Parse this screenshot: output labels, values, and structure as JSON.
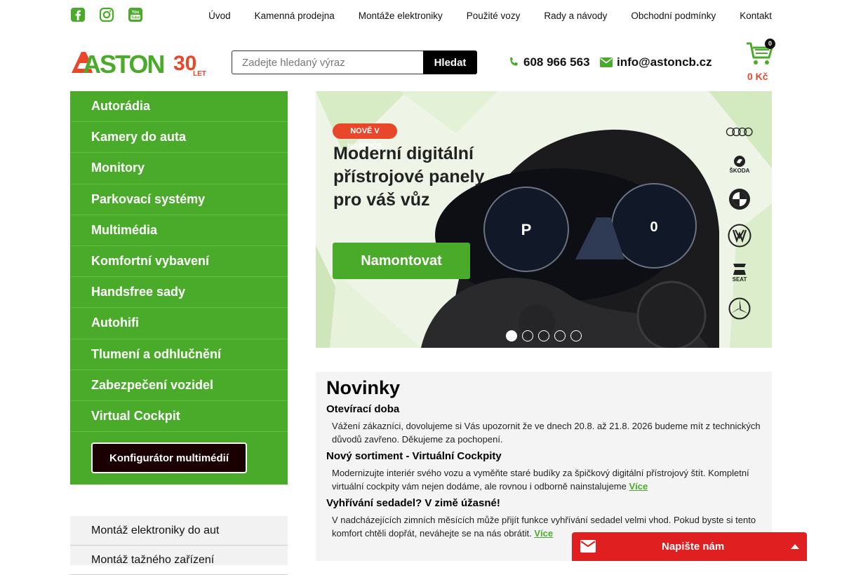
{
  "social": {
    "icons": [
      "facebook-icon",
      "instagram-icon",
      "youtube-icon"
    ],
    "color": "#4aab2b"
  },
  "topnav": [
    "Úvod",
    "Kamenná prodejna",
    "Montáže elektroniky",
    "Použité vozy",
    "Rady a návody",
    "Obchodní podmínky",
    "Kontakt"
  ],
  "logo": {
    "text": "ASTON",
    "anniversary": "30",
    "anniversary_label": "LET"
  },
  "search": {
    "placeholder": "Zadejte hledaný výraz",
    "button": "Hledat"
  },
  "contact": {
    "phone": "608 966 563",
    "email": "info@astoncb.cz"
  },
  "cart": {
    "count": "0",
    "total": "0 Kč"
  },
  "sidebar": {
    "items": [
      "Autorádia",
      "Kamery do auta",
      "Monitory",
      "Parkovací systémy",
      "Multimédia",
      "Komfortní vybavení",
      "Handsfree sady",
      "Autohifi",
      "Tlumení a odhlučnění",
      "Zabezpečení vozidel",
      "Virtual Cockpit"
    ],
    "config_button": "Konfigurátor multimédií",
    "secondary": [
      "Montáž elektroniky do aut",
      "Montáž tažného zařízení"
    ]
  },
  "banner": {
    "tag": "NOVĚ V NABÍDCE",
    "headline": "Moderní digitální přístrojové panely pro váš vůz",
    "button": "Namontovat",
    "brands": [
      "ŠKODA",
      "SEAT"
    ],
    "slides": 5,
    "active_slide": 1
  },
  "news": {
    "title": "Novinky",
    "items": [
      {
        "title": "Otevírací doba",
        "text": "Vážení zákazníci, dovolujeme si Vás upozornit že ve dnech 20.8. až 21.8. 2026 budeme mít z technických důvodů zavřeno. Děkujeme za pochopení.",
        "more": ""
      },
      {
        "title": "Nový sortiment - Virtuální Cockpity",
        "text": "Modernizujte interiér svého vozu a vyměňte staré budíky za špičkový digitální přístrojový štít. Kompletní virtuální cockpity vám nejen dodáme, ale rovnou i odborně nainstalujeme",
        "more": "Více"
      },
      {
        "title": "Vyhřívání sedadel? V zimě úžasné!",
        "text": "V nadcházejících zimních měsících může přijít funkce vyhřívání sedadel velmi vhod. Pokud byste si tento komfort chtěli dopřát, neváhejte se na nás obrátit.",
        "more": "Více"
      }
    ]
  },
  "chat": {
    "label": "Napište nám"
  },
  "colors": {
    "brand_green": "#4aab2b",
    "accent_red": "#e8472c",
    "chat_red": "#e02020"
  }
}
